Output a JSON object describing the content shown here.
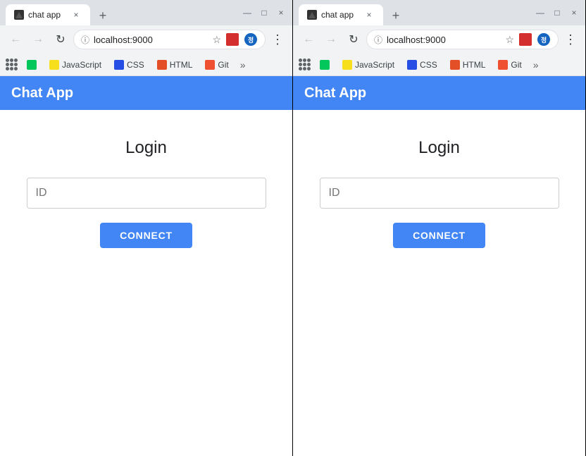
{
  "window1": {
    "tab": {
      "title": "chat app",
      "close_label": "×"
    },
    "new_tab_label": "+",
    "window_controls": {
      "minimize": "—",
      "maximize": "□",
      "close": "×"
    },
    "nav": {
      "back_label": "←",
      "forward_label": "→",
      "reload_label": "↻",
      "url": "localhost:9000",
      "lock_icon": "ⓘ",
      "star_icon": "☆",
      "menu_icon": "⋮"
    },
    "bookmarks": [
      {
        "label": "JavaScript",
        "color": "bm-js"
      },
      {
        "label": "CSS",
        "color": "bm-css"
      },
      {
        "label": "HTML",
        "color": "bm-html"
      },
      {
        "label": "Git",
        "color": "bm-git"
      }
    ],
    "more_label": "»",
    "app": {
      "header_title": "Chat App",
      "login_title": "Login",
      "id_placeholder": "ID",
      "connect_label": "CONNECT"
    }
  },
  "window2": {
    "tab": {
      "title": "chat app",
      "close_label": "×"
    },
    "new_tab_label": "+",
    "window_controls": {
      "minimize": "—",
      "maximize": "□",
      "close": "×"
    },
    "nav": {
      "back_label": "←",
      "forward_label": "→",
      "reload_label": "↻",
      "url": "localhost:9000",
      "lock_icon": "ⓘ",
      "star_icon": "☆",
      "menu_icon": "⋮"
    },
    "bookmarks": [
      {
        "label": "JavaScript",
        "color": "bm-js"
      },
      {
        "label": "CSS",
        "color": "bm-css"
      },
      {
        "label": "HTML",
        "color": "bm-html"
      },
      {
        "label": "Git",
        "color": "bm-git"
      }
    ],
    "more_label": "»",
    "app": {
      "header_title": "Chat App",
      "login_title": "Login",
      "id_placeholder": "ID",
      "connect_label": "CONNECT"
    }
  },
  "colors": {
    "header_bg": "#4285f4",
    "connect_btn": "#4285f4"
  }
}
